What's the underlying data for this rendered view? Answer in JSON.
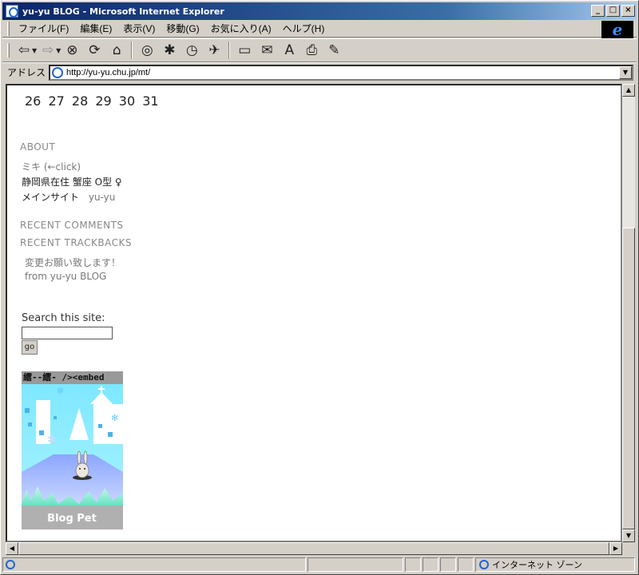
{
  "window": {
    "title": "yu-yu BLOG - Microsoft Internet Explorer"
  },
  "menu": [
    "ファイル(F)",
    "編集(E)",
    "表示(V)",
    "移動(G)",
    "お気に入り(A)",
    "ヘルプ(H)"
  ],
  "toolbar": {
    "icons": [
      "back-arrow-icon",
      "forward-arrow-icon",
      "stop-icon",
      "refresh-icon",
      "home-icon",
      "search-icon",
      "favorites-icon",
      "history-icon",
      "channels-icon",
      "fullscreen-icon",
      "mail-icon",
      "font-icon",
      "print-icon",
      "edit-icon"
    ]
  },
  "address": {
    "label": "アドレス",
    "url": "http://yu-yu.chu.jp/mt/"
  },
  "calendar": {
    "dates": "26 27 28 29 30 31"
  },
  "about": {
    "heading": "ABOUT",
    "name_link": "ミキ (←click)",
    "profile": "静岡県在住 蟹座 O型 ♀",
    "site_prefix": "メインサイト",
    "site_link": "yu-yu"
  },
  "recent_comments": {
    "heading": "RECENT COMMENTS"
  },
  "recent_trackbacks": {
    "heading": "RECENT TRACKBACKS",
    "item_title": "変更お願い致します！",
    "item_from": "from yu-yu BLOG"
  },
  "search": {
    "label": "Search this site:",
    "value": "",
    "button": "go"
  },
  "embed": {
    "title": "繧--繧- /><embed",
    "logo_text": "Blog Pet"
  },
  "status": {
    "zone": "インターネット ゾーン"
  },
  "colors": {
    "titlebar_start": "#0a246a",
    "titlebar_end": "#a6caf0",
    "chrome": "#d4d0c8"
  }
}
